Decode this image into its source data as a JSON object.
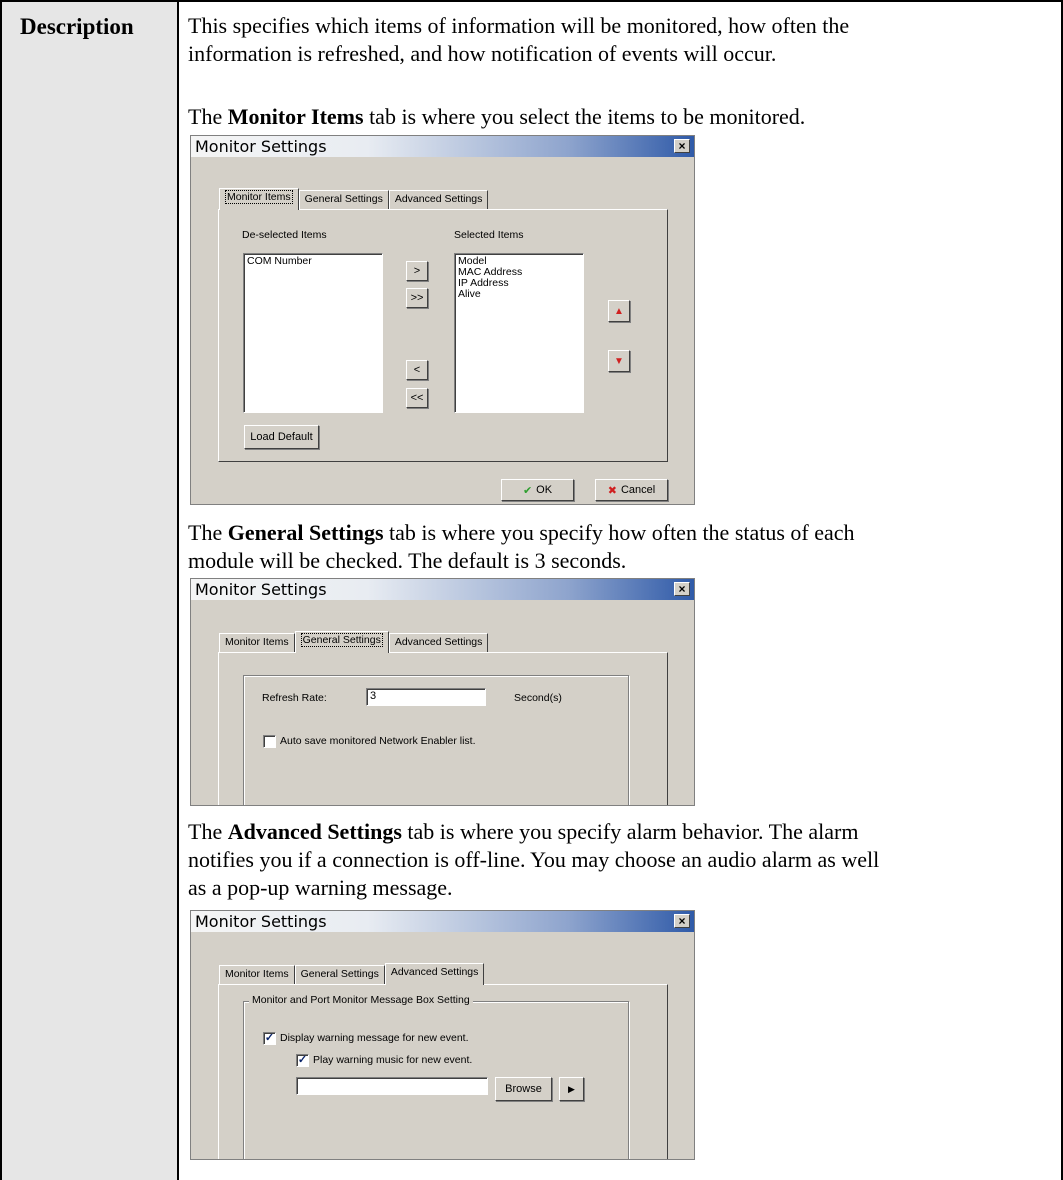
{
  "label": "Description",
  "intro": {
    "line1": "This specifies which items of information will be monitored, how often the",
    "line2": "information is refreshed, and how notification of events will occur."
  },
  "para1": {
    "pre": "The ",
    "bold": "Monitor Items",
    "post": " tab is where you select the items to be monitored."
  },
  "para2": {
    "pre": "The ",
    "bold": "General Settings",
    "post": " tab is where you specify how often the status of each",
    "line2": "module will be checked. The default is 3 seconds."
  },
  "para3": {
    "pre": "The ",
    "bold": "Advanced Settings",
    "post": " tab is where you specify alarm behavior. The alarm",
    "line2": "notifies you if a connection is off-line. You may choose an audio alarm as well",
    "line3": "as a pop-up warning message."
  },
  "dialog": {
    "title": "Monitor Settings",
    "close_glyph": "×",
    "tabs": {
      "monitor": "Monitor Items",
      "general": "General Settings",
      "advanced": "Advanced Settings"
    }
  },
  "monitor_tab": {
    "deselected_label": "De-selected Items",
    "selected_label": "Selected Items",
    "deselected_items": [
      "COM Number"
    ],
    "selected_items": [
      "Model",
      "MAC Address",
      "IP Address",
      "Alive"
    ],
    "move_right": ">",
    "move_all_right": ">>",
    "move_left": "<",
    "move_all_left": "<<",
    "up_glyph": "▲",
    "down_glyph": "▼",
    "load_default": "Load Default",
    "ok": "OK",
    "cancel": "Cancel",
    "ok_glyph": "✔",
    "cancel_glyph": "✖"
  },
  "general_tab": {
    "refresh_label": "Refresh Rate:",
    "refresh_value": "3",
    "unit": "Second(s)",
    "auto_save": "Auto save monitored Network Enabler list.",
    "auto_save_checked": false
  },
  "advanced_tab": {
    "group_title": "Monitor and Port Monitor Message Box Setting",
    "display_warning": "Display warning message for new event.",
    "display_warning_checked": true,
    "play_music": "Play warning music for new event.",
    "play_music_checked": true,
    "file_value": "",
    "browse": "Browse",
    "play_glyph": "▶"
  },
  "colors": {
    "dialog_bg": "#d4d0c8",
    "label_bg": "#e6e6e6",
    "title_blue": "#2f5aa8"
  }
}
